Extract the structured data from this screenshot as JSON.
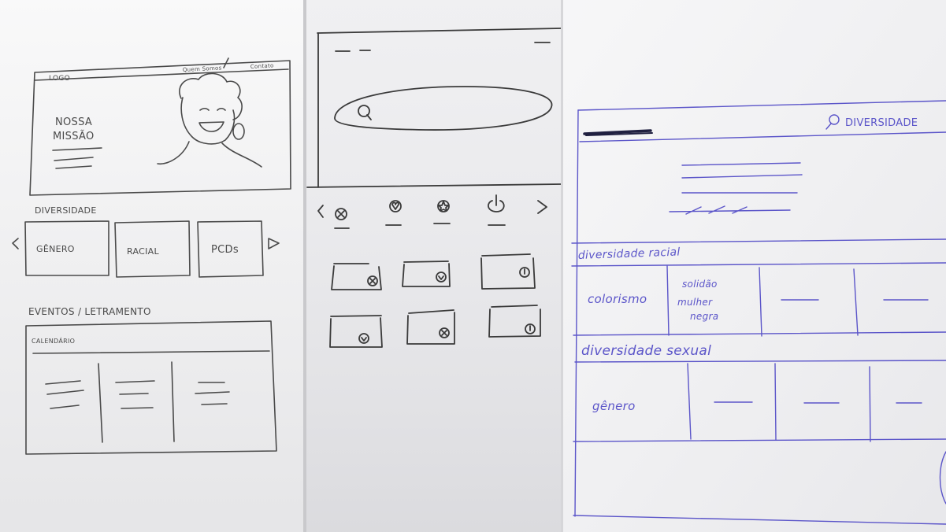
{
  "wireframe_left": {
    "logo": "LOGO",
    "nav_link_1": "Quem Somos",
    "nav_link_2": "Contato",
    "hero_title_line_1": "NOSSA",
    "hero_title_line_2": "MISSÃO",
    "diversity_heading": "DIVERSIDADE",
    "category_1": "GÊNERO",
    "category_2": "RACIAL",
    "category_3": "PCDs",
    "events_heading": "EVENTOS / LETRAMENTO",
    "calendar_label": "CALENDÁRIO"
  },
  "wireframe_right": {
    "search_label": "DIVERSIDADE",
    "section_1_heading": "diversidade racial",
    "section_1_cell_1": "colorismo",
    "section_1_cell_2_line_1": "solidão",
    "section_1_cell_2_line_2": "mulher",
    "section_1_cell_2_line_3": "negra",
    "section_2_heading": "diversidade sexual",
    "section_2_cell_1": "gênero"
  },
  "colors": {
    "pencil": "#4a4a4a",
    "pen_blue": "#5b55c9",
    "paper_left": "#f3f3f4",
    "paper_middle": "#e9e9ec",
    "paper_right": "#f1f1f3"
  },
  "icons": [
    "close-circle-icon",
    "heart-icon",
    "star-icon",
    "power-icon",
    "search-icon",
    "chevron-left-icon",
    "chevron-right-icon"
  ]
}
